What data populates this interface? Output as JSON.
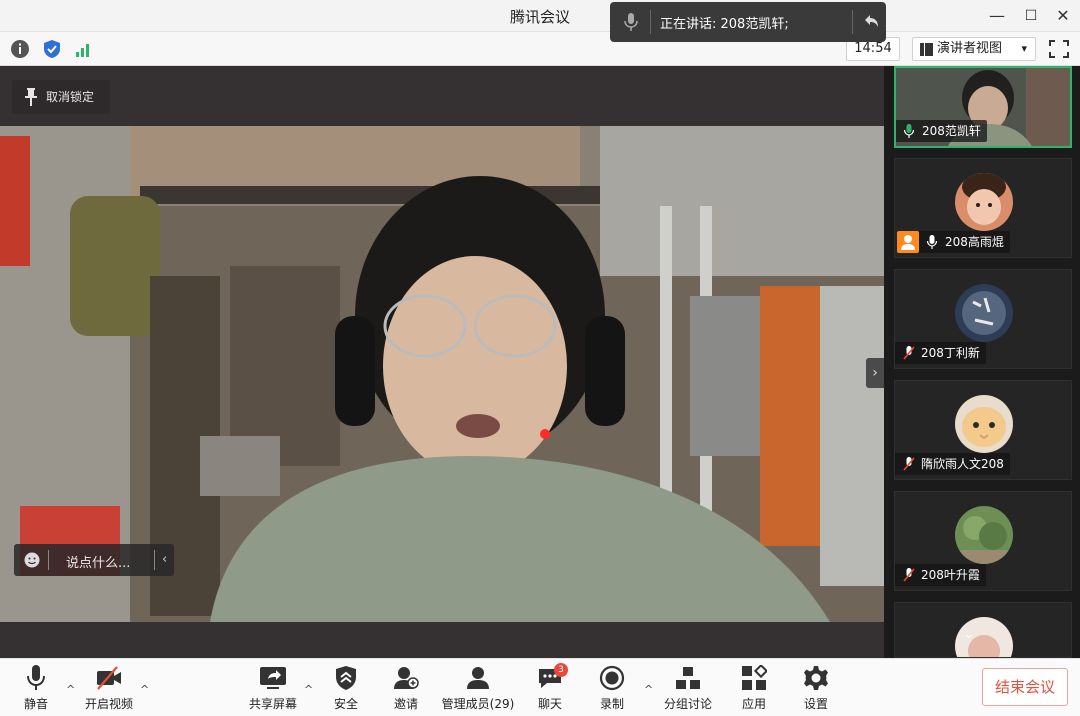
{
  "window": {
    "title": "腾讯会议",
    "minimize": "—",
    "maximize": "☐",
    "close": "✕"
  },
  "statusbar": {
    "time": "14:54",
    "view_label": "演讲者视图",
    "view_caret": "▾",
    "icons": [
      "info-icon",
      "shield-icon",
      "signal-icon",
      "fullscreen-icon"
    ]
  },
  "toast": {
    "speaking_text": "正在讲话: 208范凯轩;"
  },
  "stage": {
    "unpin_label": "取消锁定",
    "chat_placeholder": "说点什么...",
    "chat_chevron": "‹",
    "side_toggle": "›"
  },
  "participants": [
    {
      "name": "208范凯轩",
      "mic": "on",
      "active": true,
      "host": false
    },
    {
      "name": "208高雨焜",
      "mic": "on",
      "active": false,
      "host": true
    },
    {
      "name": "208丁利新",
      "mic": "muted",
      "active": false,
      "host": false
    },
    {
      "name": "隋欣雨人文208",
      "mic": "muted",
      "active": false,
      "host": false
    },
    {
      "name": "208叶升霞",
      "mic": "muted",
      "active": false,
      "host": false
    }
  ],
  "participant_scroll": "⌄",
  "toolbar": {
    "mute": "静音",
    "video": "开启视频",
    "share": "共享屏幕",
    "security": "安全",
    "invite": "邀请",
    "members": "管理成员(29)",
    "chat": "聊天",
    "chat_badge": "3",
    "record": "录制",
    "breakout": "分组讨论",
    "apps": "应用",
    "settings": "设置",
    "end": "结束会议",
    "caret": "^"
  },
  "colors": {
    "accent_green": "#2fb36a",
    "end_red": "#e0533f",
    "host_orange": "#ff8a1f"
  }
}
